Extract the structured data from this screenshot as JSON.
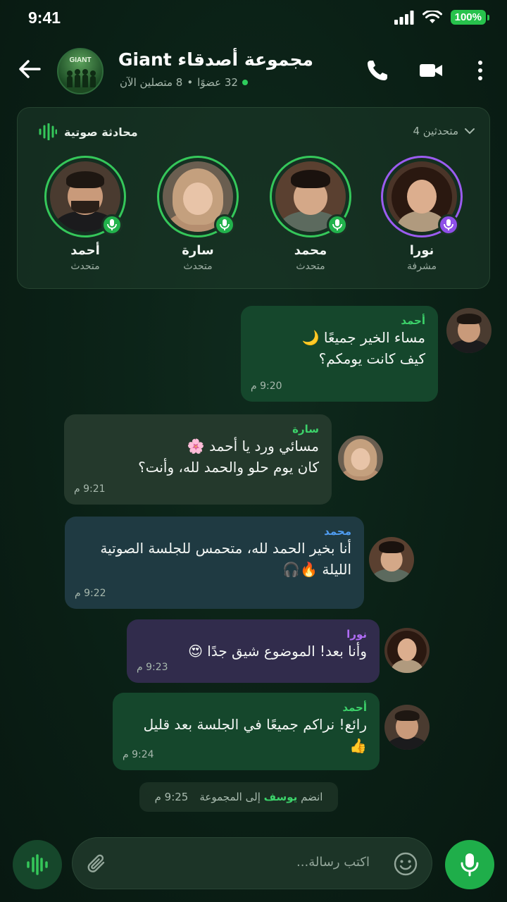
{
  "status_bar": {
    "time": "9:41",
    "battery": "100%"
  },
  "header": {
    "group_name": "مجموعة أصدقاء Giant",
    "avatar_label": "GIANT",
    "members": "32 عضوًا",
    "separator": "•",
    "online": "8 متصلين الآن"
  },
  "voice": {
    "title": "محادثة صوتية",
    "speaker_count": "4 متحدثين",
    "speakers": [
      {
        "name": "أحمد",
        "role": "متحدث"
      },
      {
        "name": "سارة",
        "role": "متحدث"
      },
      {
        "name": "محمد",
        "role": "متحدث"
      },
      {
        "name": "نورا",
        "role": "مشرفة"
      }
    ]
  },
  "messages": [
    {
      "sender": "أحمد",
      "lines": [
        "مساء الخير جميعًا 🌙",
        "كيف كانت يومكم؟"
      ],
      "time": "9:20 م"
    },
    {
      "sender": "سارة",
      "lines": [
        "مسائي ورد يا أحمد 🌸",
        "كان يوم حلو والحمد لله، وأنت؟"
      ],
      "time": "9:21 م"
    },
    {
      "sender": "محمد",
      "lines": [
        "أنا بخير الحمد لله، متحمس للجلسة الصوتية",
        "الليلة 🔥🎧"
      ],
      "time": "9:22 م"
    },
    {
      "sender": "نورا",
      "lines": [
        "وأنا بعد! الموضوع شيق جدًا 😍"
      ],
      "time": "9:23 م"
    },
    {
      "sender": "أحمد",
      "lines": [
        "رائع! نراكم جميعًا في الجلسة بعد قليل 👍"
      ],
      "time": "9:24 م"
    }
  ],
  "system_message": {
    "prefix": "انضم",
    "name": "يوسف",
    "suffix": "إلى المجموعة",
    "time": "9:25 م"
  },
  "composer": {
    "placeholder": "اكتب رسالة..."
  },
  "colors": {
    "accent": "#2ecc5c",
    "admin": "#9b5cf0",
    "sender_green": "#3cd26a",
    "sender_blue": "#4f9cf0",
    "sender_purple": "#b06cf5"
  }
}
